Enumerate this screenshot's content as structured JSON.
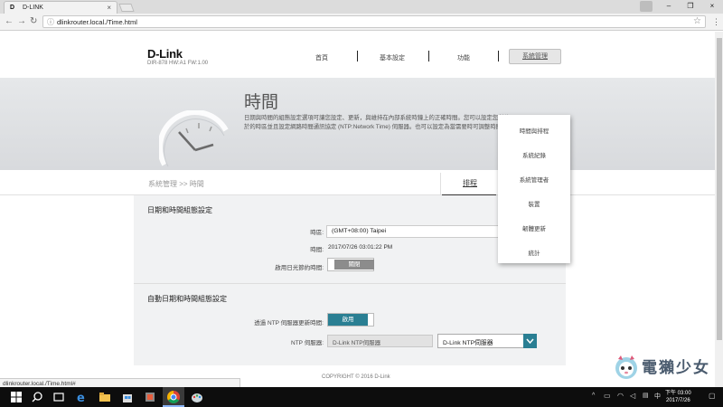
{
  "browser": {
    "tab_title": "D-LINK",
    "tab_favicon": "D",
    "url": "dlinkrouter.local./Time.html",
    "status_url": "dlinkrouter.local./Time.html#"
  },
  "header": {
    "logo": "D-Link",
    "model": "DIR-878 HW:A1 FW:1.00",
    "nav": [
      "首頁",
      "基本設定",
      "功能",
      "系統管理"
    ]
  },
  "hero": {
    "title": "時間",
    "description": "日期與時間的組態設定選項可讓您設定、更新，與維持在內部系統時鐘上的正確時間。您可以設定您所位於的時區並且設定網路時間通訊協定 (NTP:Network Time) 伺服器。也可以設定為當需要時可調整時間。"
  },
  "breadcrumb": {
    "path": "系統管理 >> 時間",
    "schedule_link": "排程"
  },
  "section_datetime": {
    "title": "日期和時間組態設定",
    "timezone_label": "時區:",
    "timezone_value": "(GMT+08:00) Taipei",
    "time_label": "時間:",
    "time_value": "2017/07/26 03:01:22 PM",
    "dst_label": "啟用日光節約時間:",
    "dst_state": "關閉"
  },
  "section_ntp": {
    "title": "自動日期和時間組態設定",
    "ntp_update_label": "透過 NTP 伺服器更新時間:",
    "ntp_update_state": "啟用",
    "ntp_server_label": "NTP 伺服器:",
    "ntp_server_input": "D-Link NTP伺服器",
    "ntp_server_select": "D-Link NTP伺服器"
  },
  "dropdown_menu": [
    "時間與排程",
    "系統紀錄",
    "系統管理者",
    "裝置",
    "韌體更新",
    "統計"
  ],
  "footer": {
    "copyright": "COPYRIGHT © 2016 D-Link"
  },
  "taskbar": {
    "time": "下午 03:00",
    "date": "2017/7/26"
  },
  "watermark": {
    "text": "電獺少女"
  },
  "colors": {
    "accent": "#2a7f93",
    "toggle_off": "#8c8c8c",
    "hero_bg": "#dcdfe2"
  }
}
